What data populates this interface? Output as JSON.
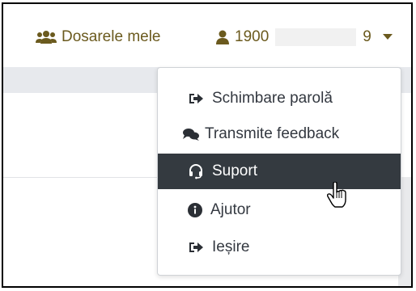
{
  "header": {
    "cases_label": "Dosarele mele",
    "user_prefix": "1900",
    "user_suffix": "9"
  },
  "dropdown": {
    "items": [
      {
        "label": "Schimbare parolă",
        "icon": "change-password-icon",
        "active": false
      },
      {
        "label": "Transmite feedback",
        "icon": "comments-icon",
        "active": false
      },
      {
        "label": "Suport",
        "icon": "headset-icon",
        "active": true
      },
      {
        "label": "Ajutor",
        "icon": "info-circle-icon",
        "active": false
      },
      {
        "label": "Ieșire",
        "icon": "sign-out-icon",
        "active": false
      }
    ]
  },
  "colors": {
    "nav_text": "#6b5a1e",
    "active_bg": "#343a40",
    "menu_text": "#333840"
  }
}
